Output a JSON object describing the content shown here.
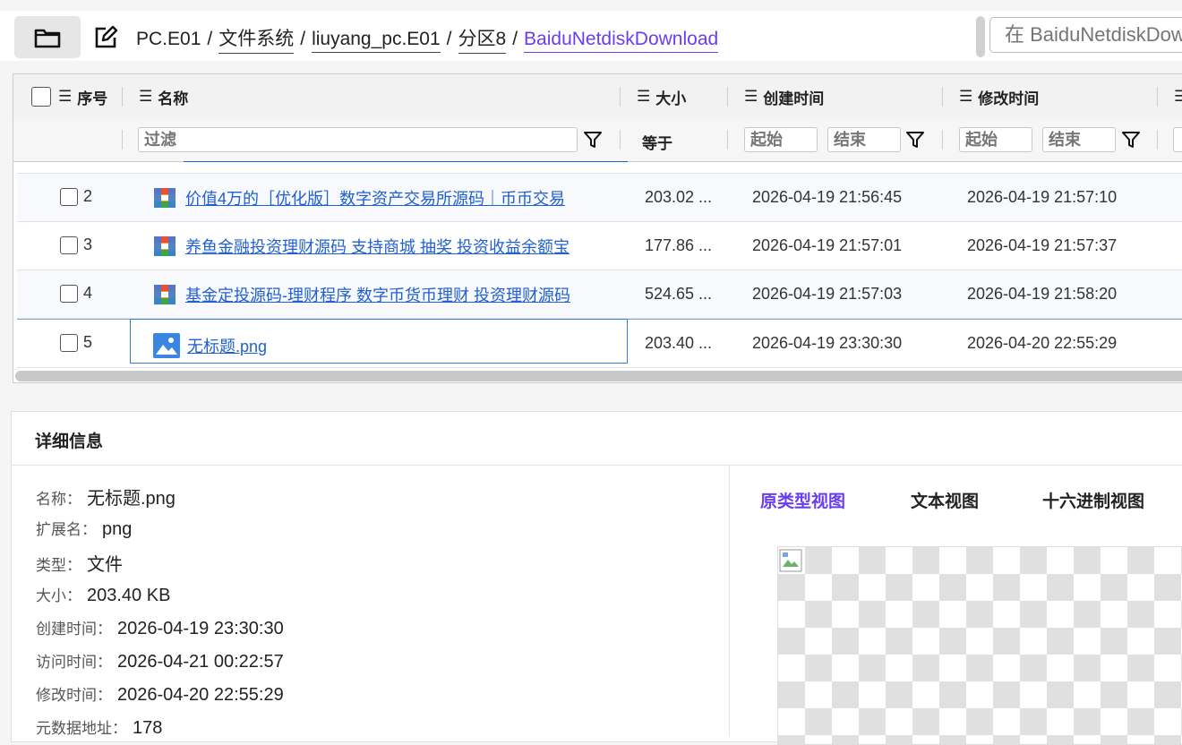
{
  "breadcrumb": {
    "items": [
      "PC.E01",
      "文件系统",
      "liuyang_pc.E01",
      "分区8"
    ],
    "current": "BaiduNetdiskDownload",
    "separator": "/"
  },
  "search": {
    "placeholder": "在 BaiduNetdiskDownload"
  },
  "table": {
    "headers": {
      "index": "序号",
      "name": "名称",
      "size": "大小",
      "ctime": "创建时间",
      "mtime": "修改时间"
    },
    "filters": {
      "name_placeholder": "过滤",
      "size_op": "等于",
      "range_start": "起始",
      "range_end": "结束"
    },
    "rows": [
      {
        "idx": "2",
        "icon": "archive-icon",
        "name": "价值4万的［优化版］数字资产交易所源码｜币币交易",
        "size": "203.02 ...",
        "ctime": "2026-04-19 21:56:45",
        "mtime": "2026-04-19 21:57:10"
      },
      {
        "idx": "3",
        "icon": "archive-icon",
        "name": "养鱼金融投资理财源码 支持商城 抽奖 投资收益余额宝",
        "size": "177.86 ...",
        "ctime": "2026-04-19 21:57:01",
        "mtime": "2026-04-19 21:57:37"
      },
      {
        "idx": "4",
        "icon": "archive-icon",
        "name": "基金定投源码-理财程序 数字币货币理财 投资理财源码",
        "size": "524.65 ...",
        "ctime": "2026-04-19 21:57:03",
        "mtime": "2026-04-19 21:58:20"
      },
      {
        "idx": "5",
        "icon": "image-file-icon",
        "name": "无标题.png",
        "size": "203.40 ...",
        "ctime": "2026-04-19 23:30:30",
        "mtime": "2026-04-20 22:55:29"
      }
    ]
  },
  "details": {
    "title": "详细信息",
    "fields": [
      {
        "label": "名称：",
        "value": "无标题.png"
      },
      {
        "label": "扩展名：",
        "value": "png"
      },
      {
        "label": "类型：",
        "value": "文件"
      },
      {
        "label": "大小：",
        "value": "203.40 KB"
      },
      {
        "label": "创建时间：",
        "value": "2026-04-19 23:30:30"
      },
      {
        "label": "访问时间：",
        "value": "2026-04-21 00:22:57"
      },
      {
        "label": "修改时间：",
        "value": "2026-04-20 22:55:29"
      },
      {
        "label": "元数据地址：",
        "value": "178"
      }
    ],
    "view_tabs": [
      "原类型视图",
      "文本视图",
      "十六进制视图"
    ],
    "active_tab_color": "#6a3df0"
  }
}
